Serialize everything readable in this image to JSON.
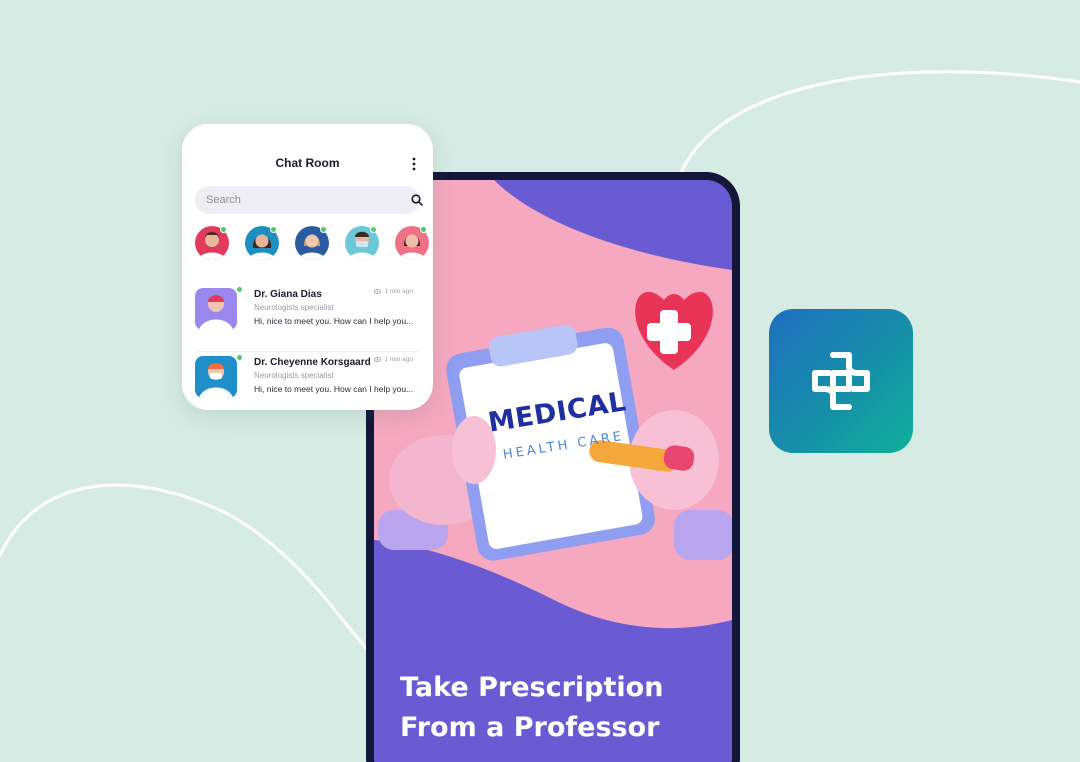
{
  "colors": {
    "background": "#d6ebe3",
    "phone_frame": "#14163a",
    "screen_purple": "#6a5bd3",
    "screen_pink": "#f5a8bf",
    "online": "#4ccd72",
    "app_icon_from": "#1f6fbf",
    "app_icon_to": "#0fb09a"
  },
  "chat_room": {
    "title": "Chat Room",
    "menu_icon": "kebab-menu-icon",
    "search": {
      "placeholder": "Search",
      "icon": "search-icon"
    },
    "stories": [
      {
        "name": "doctor-1",
        "online": true
      },
      {
        "name": "doctor-2",
        "online": true
      },
      {
        "name": "doctor-3",
        "online": true
      },
      {
        "name": "doctor-4",
        "online": true
      },
      {
        "name": "doctor-5",
        "online": true
      }
    ],
    "conversations": [
      {
        "name": "Dr. Giana Dias",
        "role": "Neurologists specialist",
        "message": "Hi, nice to meet you. How can I help you...",
        "time": "1 min ago",
        "online": true
      },
      {
        "name": "Dr. Cheyenne Korsgaard",
        "role": "Neurologists specialist",
        "message": "Hi, nice to meet you. How can I help you...",
        "time": "1 min ago",
        "online": true
      }
    ]
  },
  "phone_screen": {
    "clipboard_title": "MEDICAL",
    "clipboard_subtitle": "HEALTH CARE",
    "headline_line1": "Take Prescription",
    "headline_line2": "From a Professor"
  },
  "app_icon": {
    "icon": "medical-cross-logo-icon"
  }
}
